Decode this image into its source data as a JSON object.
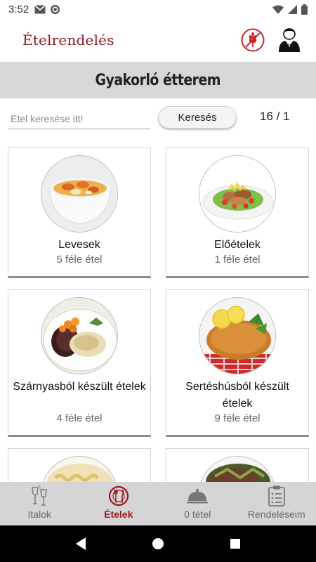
{
  "status_bar": {
    "time": "3:52"
  },
  "header": {
    "title": "Ételrendelés",
    "accent_color": "#8e1e22"
  },
  "restaurant": {
    "name": "Gyakorló étterem"
  },
  "search": {
    "placeholder": "Étel keresése itt!",
    "value": "",
    "button_label": "Keresés",
    "page_counter": "16 / 1"
  },
  "categories": [
    {
      "name": "Levesek",
      "count": "5 féle étel",
      "icon": "soup-photo"
    },
    {
      "name": "Előételek",
      "count": "1 féle étel",
      "icon": "appetizer-photo"
    },
    {
      "name": "Szárnyasból készült ételek",
      "count": "4 féle étel",
      "icon": "poultry-photo"
    },
    {
      "name": "Sertéshúsból készült ételek",
      "count": "9 féle étel",
      "icon": "pork-photo"
    },
    {
      "name": "",
      "count": "",
      "icon": "pasta-photo"
    },
    {
      "name": "",
      "count": "",
      "icon": "dish-photo"
    }
  ],
  "bottom_nav": [
    {
      "label": "Italok",
      "icon": "wine-glasses-icon",
      "active": false
    },
    {
      "label": "Ételek",
      "icon": "plate-cutlery-icon",
      "active": true
    },
    {
      "label": "0 tétel",
      "icon": "cloche-icon",
      "active": false
    },
    {
      "label": "Rendeléseim",
      "icon": "clipboard-icon",
      "active": false
    }
  ]
}
